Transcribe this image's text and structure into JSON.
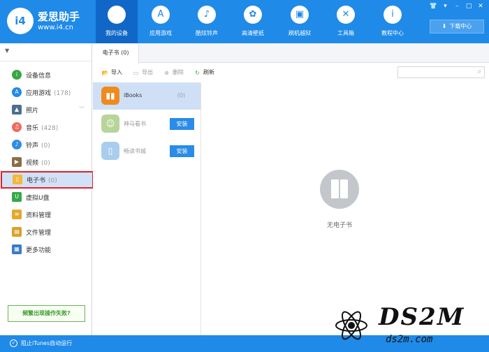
{
  "header": {
    "logo_badge": "i4",
    "logo_name": "爱思助手",
    "logo_url": "www.i4.cn",
    "nav": [
      {
        "label": "我的设备",
        "icon": "apple-icon",
        "glyph": "",
        "active": true
      },
      {
        "label": "应用游戏",
        "icon": "app-store-icon",
        "glyph": "A"
      },
      {
        "label": "酷炫铃声",
        "icon": "bell-icon",
        "glyph": "♪"
      },
      {
        "label": "高清壁纸",
        "icon": "flower-icon",
        "glyph": "✿"
      },
      {
        "label": "刷机越狱",
        "icon": "box-icon",
        "glyph": "▣"
      },
      {
        "label": "工具箱",
        "icon": "tools-icon",
        "glyph": "✕"
      },
      {
        "label": "教程中心",
        "icon": "info-icon",
        "glyph": "i"
      }
    ],
    "download_label": "下载中心",
    "window_controls": [
      "👕",
      "▾",
      "–",
      "□",
      "✕"
    ]
  },
  "sidebar": {
    "items": [
      {
        "label": "设备信息",
        "count": "",
        "icon": "info-icon",
        "glyph": "i",
        "color": "#3aa545"
      },
      {
        "label": "应用游戏",
        "count": "(178)",
        "icon": "app-store-icon",
        "glyph": "A",
        "color": "#1f8ae8"
      },
      {
        "label": "照片",
        "count": "",
        "icon": "photo-icon",
        "glyph": "▲",
        "color": "#4d6f8f",
        "chevron": "﹀"
      },
      {
        "label": "音乐",
        "count": "(428)",
        "icon": "music-icon",
        "glyph": "♫",
        "color": "#f06a5c"
      },
      {
        "label": "铃声",
        "count": "(0)",
        "icon": "bell-icon",
        "glyph": "♪",
        "color": "#2f8ce6"
      },
      {
        "label": "视频",
        "count": "(0)",
        "icon": "video-icon",
        "glyph": "▶",
        "color": "#8b6e46"
      },
      {
        "label": "电子书",
        "count": "(0)",
        "icon": "book-icon",
        "glyph": "▯",
        "color": "#f3b73a",
        "active": true
      },
      {
        "label": "虚拟U盘",
        "count": "",
        "icon": "usb-icon",
        "glyph": "U",
        "color": "#35a847"
      },
      {
        "label": "资料管理",
        "count": "",
        "icon": "contacts-icon",
        "glyph": "≡",
        "color": "#e3a92e"
      },
      {
        "label": "文件管理",
        "count": "",
        "icon": "folder-icon",
        "glyph": "▤",
        "color": "#d9a12c"
      },
      {
        "label": "更多功能",
        "count": "",
        "icon": "grid-icon",
        "glyph": "▦",
        "color": "#3a7cc7"
      }
    ],
    "help_label": "频繁出现操作失败?"
  },
  "statusbar": {
    "label": "阻止iTunes自动运行"
  },
  "main": {
    "tab_label": "电子书 (0)",
    "toolbar": {
      "import_label": "导入",
      "export_label": "导出",
      "delete_label": "删除",
      "refresh_label": "刷新"
    },
    "apps": [
      {
        "name": "iBooks",
        "count": "(0)",
        "icon": "ibooks-icon",
        "glyph": "▮▮",
        "color": "#f08a1e",
        "selected": true
      },
      {
        "name": "神马看书",
        "install_label": "安装",
        "icon": "shenma-icon",
        "glyph": "☺",
        "color": "#b9d49a"
      },
      {
        "name": "畅读书城",
        "install_label": "安装",
        "icon": "changdu-icon",
        "glyph": "▯",
        "color": "#a9cdee"
      }
    ],
    "empty_label": "无电子书"
  },
  "watermark": {
    "title": "DS2M",
    "subtitle": "ds2m.com"
  }
}
